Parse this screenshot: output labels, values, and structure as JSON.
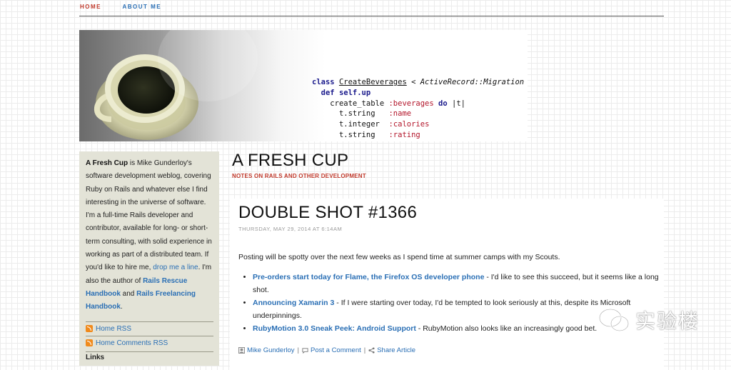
{
  "nav": {
    "home": "HOME",
    "about": "ABOUT ME"
  },
  "banner": {
    "code": {
      "line1_kw": "class",
      "line1_cls": "CreateBeverages",
      "line1_rest": "< ActiveRecord::Migration",
      "line2_kw": "def",
      "line2_rest": "self.up",
      "line3_a": "create_table",
      "line3_sym": ":beverages",
      "line3_kw": "do",
      "line3_b": "|t|",
      "line4_a": "t.string",
      "line4_sym": ":name",
      "line5_a": "t.integer",
      "line5_sym": ":calories",
      "line6_a": "t.string",
      "line6_sym": ":rating"
    }
  },
  "site": {
    "title": "A FRESH CUP",
    "subtitle": "NOTES ON RAILS AND OTHER DEVELOPMENT"
  },
  "sidebar": {
    "about_bold": "A Fresh Cup",
    "about_1": " is Mike Gunderloy's software development weblog, covering Ruby on Rails and whatever else I find interesting in the universe of software. I'm a full-time Rails developer and contributor, available for long- or short-term consulting, with solid experience in working as part of a distributed team. If you'd like to hire me, ",
    "hire_link": "drop me a line",
    "about_2": ". I'm also the author of ",
    "book1": "Rails Rescue Handbook",
    "about_3": " and ",
    "book2": "Rails Freelancing Handbook",
    "about_4": ".",
    "rss_home": "Home RSS",
    "rss_comments": "Home Comments RSS",
    "links_heading": "Links"
  },
  "post": {
    "title": "DOUBLE SHOT #1366",
    "date": "THURSDAY, MAY 29, 2014 AT 6:14AM",
    "intro": "Posting will be spotty over the next few weeks as I spend time at summer camps with my Scouts.",
    "items": [
      {
        "link": "Pre-orders start today for Flame, the Firefox OS developer phone",
        "text": " - I'd like to see this succeed, but it seems like a long shot."
      },
      {
        "link": "Announcing Xamarin 3",
        "text": " - If I were starting over today, I'd be tempted to look seriously at this, despite its Microsoft underpinnings."
      },
      {
        "link": "RubyMotion 3.0 Sneak Peek: Android Support",
        "text": " - RubyMotion also looks like an increasingly good bet."
      }
    ],
    "meta": {
      "author": "Mike Gunderloy",
      "comment": "Post a Comment",
      "share": "Share Article",
      "sep": "|"
    }
  },
  "watermark": {
    "text": "实验楼"
  }
}
